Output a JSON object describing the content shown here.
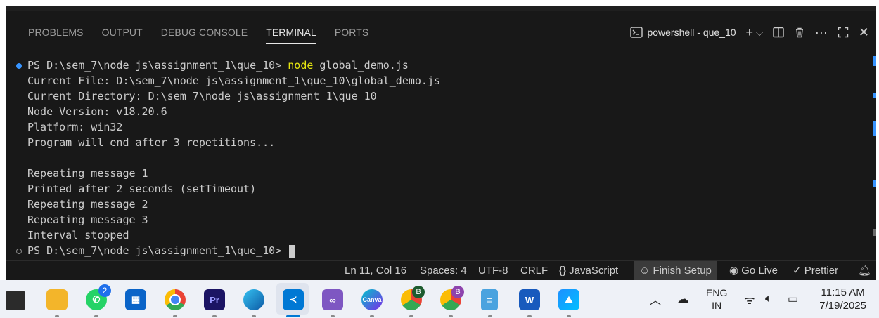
{
  "panel": {
    "tabs": [
      {
        "label": "PROBLEMS",
        "active": false
      },
      {
        "label": "OUTPUT",
        "active": false
      },
      {
        "label": "DEBUG CONSOLE",
        "active": false
      },
      {
        "label": "TERMINAL",
        "active": true
      },
      {
        "label": "PORTS",
        "active": false
      }
    ],
    "terminal_name": "powershell - que_10"
  },
  "terminal": {
    "prompt1": "PS D:\\sem_7\\node js\\assignment_1\\que_10> ",
    "command": "node",
    "command_arg": " global_demo.js",
    "output": [
      "Current File: D:\\sem_7\\node js\\assignment_1\\que_10\\global_demo.js",
      "Current Directory: D:\\sem_7\\node js\\assignment_1\\que_10",
      "Node Version: v18.20.6",
      "Platform: win32",
      "Program will end after 3 repetitions...",
      "",
      "Repeating message 1",
      "Printed after 2 seconds (setTimeout)",
      "Repeating message 2",
      "Repeating message 3",
      "Interval stopped"
    ],
    "prompt2": "PS D:\\sem_7\\node js\\assignment_1\\que_10> "
  },
  "statusbar": {
    "position": "Ln 11, Col 16",
    "spaces": "Spaces: 4",
    "encoding": "UTF-8",
    "eol": "CRLF",
    "language": "{} JavaScript",
    "finish_setup": "Finish Setup",
    "go_live": "Go Live",
    "prettier": "Prettier"
  },
  "taskbar": {
    "whatsapp_badge": "2",
    "chrome_badge_1": "B",
    "chrome_badge_2": "B",
    "lang_top": "ENG",
    "lang_bottom": "IN",
    "time": "11:15 AM",
    "date": "7/19/2025"
  },
  "colors": {
    "accent": "#3794ff",
    "command": "#e5e510",
    "terminal_bg": "#181818"
  }
}
